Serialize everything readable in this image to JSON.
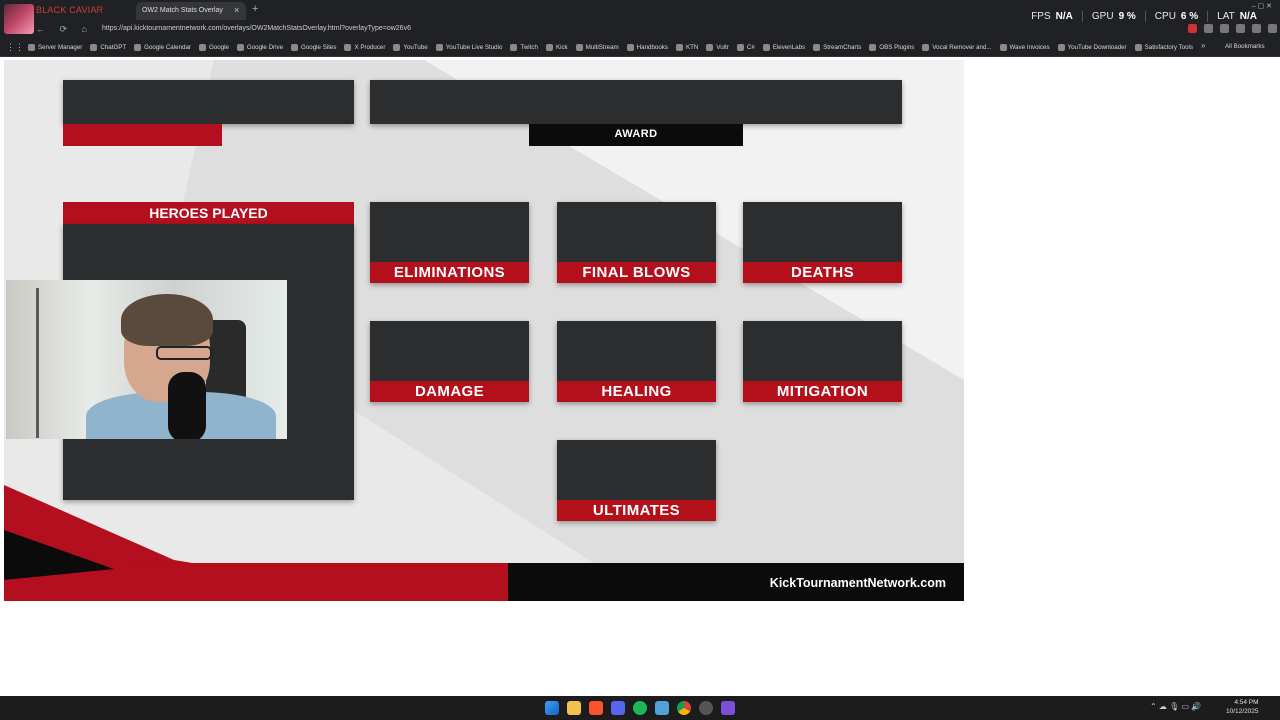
{
  "browser": {
    "media_title": "BLACK CAVIAR",
    "tab_title": "OW2 Match Stats Overlay",
    "tab_close": "×",
    "new_tab": "+",
    "nav_icons": "← ⟳ ⌂",
    "url": "https://api.kicktournamentnetwork.com/overlays/OW2MatchStatsOverlay.html?overlayType=ow26v6",
    "window_controls": "–  ▢  ✕",
    "perf": [
      {
        "label": "FPS",
        "value": "N/A"
      },
      {
        "label": "GPU",
        "value": "9 %"
      },
      {
        "label": "CPU",
        "value": "6 %"
      },
      {
        "label": "LAT",
        "value": "N/A"
      }
    ],
    "apps_icon": "⋮⋮",
    "more_bookmarks": "»",
    "all_bookmarks": "All Bookmarks",
    "bookmarks": [
      "Server Manager",
      "ChatGPT",
      "Google Calendar",
      "Google",
      "Google Drive",
      "Google Sites",
      "X Producer",
      "YouTube",
      "YouTube Live Studio",
      "Twitch",
      "Kick",
      "MultiStream",
      "Handbooks",
      "KTN",
      "Vultr",
      "C#",
      "ElevenLabs",
      "StreamCharts",
      "OBS Plugins",
      "Vocal Remover and...",
      "Wave Invoices",
      "YouTube Downloader",
      "Satisfactory Tools"
    ]
  },
  "overlay": {
    "award_label": "AWARD",
    "heroes_played_label": "HEROES PLAYED",
    "stats": {
      "eliminations": "ELIMINATIONS",
      "final_blows": "FINAL BLOWS",
      "deaths": "DEATHS",
      "damage": "DAMAGE",
      "healing": "HEALING",
      "mitigation": "MITIGATION",
      "ultimates": "ULTIMATES"
    },
    "footer_site": "KickTournamentNetwork.com",
    "colors": {
      "panel": "#2c2d2f",
      "accent_red": "#b30f1e",
      "background": "#f2f2f2",
      "black": "#0b0b0b"
    }
  },
  "taskbar": {
    "clock_time": "4:54 PM",
    "clock_date": "10/12/2025",
    "tray_icons": "⌃ ☁ 🎙 ▭ 🔊"
  }
}
